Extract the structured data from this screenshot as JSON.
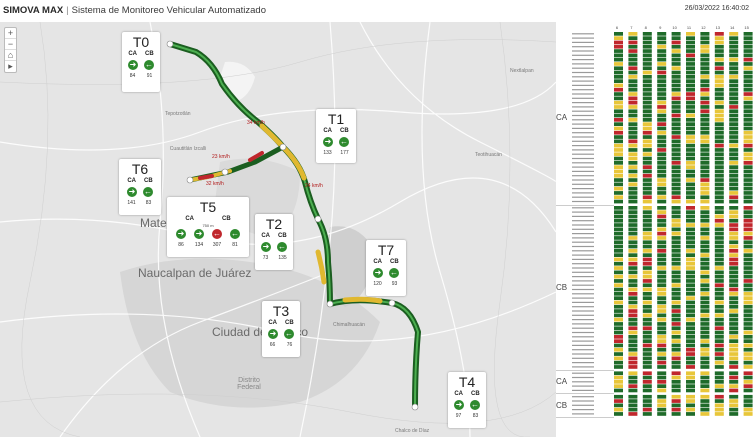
{
  "header": {
    "brand": "SIMOVA MAX",
    "subtitle": "Sistema de Monitoreo Vehicular Automatizado",
    "timestamp": "26/03/2022 16:40:02"
  },
  "map": {
    "zoom_in": "+",
    "zoom_out": "−",
    "home": "⌂",
    "play": "▸",
    "labels": {
      "tepotzotlan": "Tepotzotlán",
      "cuautitlan": "Cuautitlán Izcalli",
      "nextlalpan": "Nextlalpan",
      "teotihuacan": "Teotihuacán",
      "naucalpan": "Naucalpan de Juárez",
      "mateo": "Mateo",
      "ciudad": "Ciudad de México",
      "chimalhuacan": "Chimalhuacán",
      "distrito": "Distrito Federal",
      "chalco": "Chalco de Díaz"
    },
    "speed_labels": {
      "s1": "34 km/h",
      "s2": "23 km/h",
      "s3": "32 km/h",
      "s4": "24 km/h"
    },
    "t5_distance": "750 m"
  },
  "cards": [
    {
      "id": "T0",
      "ca": "CA",
      "cb": "CB",
      "v1": "84",
      "v2": "91"
    },
    {
      "id": "T1",
      "ca": "CA",
      "cb": "CB",
      "v1": "133",
      "v2": "177"
    },
    {
      "id": "T6",
      "ca": "CA",
      "cb": "CB",
      "v1": "141",
      "v2": "83"
    },
    {
      "id": "T5",
      "ca": "CA",
      "cb": "CB",
      "v1": "86",
      "v2": "134",
      "v3": "307",
      "v4": "81"
    },
    {
      "id": "T2",
      "ca": "CA",
      "cb": "CB",
      "v1": "73",
      "v2": "135"
    },
    {
      "id": "T7",
      "ca": "CA",
      "cb": "CB",
      "v1": "120",
      "v2": "93"
    },
    {
      "id": "T3",
      "ca": "CA",
      "cb": "CB",
      "v1": "66",
      "v2": "76"
    },
    {
      "id": "T4",
      "ca": "CA",
      "cb": "CB",
      "v1": "97",
      "v2": "83"
    }
  ],
  "panel": {
    "hours": [
      "6",
      "7",
      "8",
      "9",
      "10",
      "11",
      "12",
      "13",
      "14",
      "15",
      "16"
    ],
    "groups": [
      {
        "label": "CA",
        "rows": 40
      },
      {
        "label": "CB",
        "rows": 38
      },
      {
        "label": "CA",
        "rows": 5
      },
      {
        "label": "CB",
        "rows": 5
      }
    ],
    "colors": {
      "green": "#1f6b2a",
      "yellow": "#e8c63a",
      "red": "#c0272d"
    }
  }
}
